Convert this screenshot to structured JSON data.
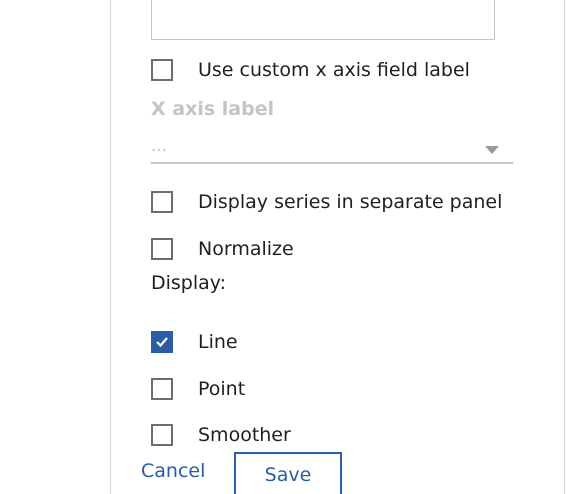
{
  "form": {
    "custom_x_label": {
      "label": "Use custom x axis field label",
      "checked": false
    },
    "x_axis_label": {
      "label": "X axis label",
      "value": "..."
    },
    "separate_panel": {
      "label": "Display series in separate panel",
      "checked": false
    },
    "normalize": {
      "label": "Normalize",
      "checked": false
    },
    "display": {
      "heading": "Display:",
      "options": [
        {
          "label": "Line",
          "checked": true
        },
        {
          "label": "Point",
          "checked": false
        },
        {
          "label": "Smoother",
          "checked": false
        }
      ]
    }
  },
  "footer": {
    "cancel_label": "Cancel",
    "save_label": "Save"
  },
  "colors": {
    "accent": "#2d5ca6",
    "disabled_text": "#c4c4c4",
    "checkbox_border": "#6b6f73"
  }
}
